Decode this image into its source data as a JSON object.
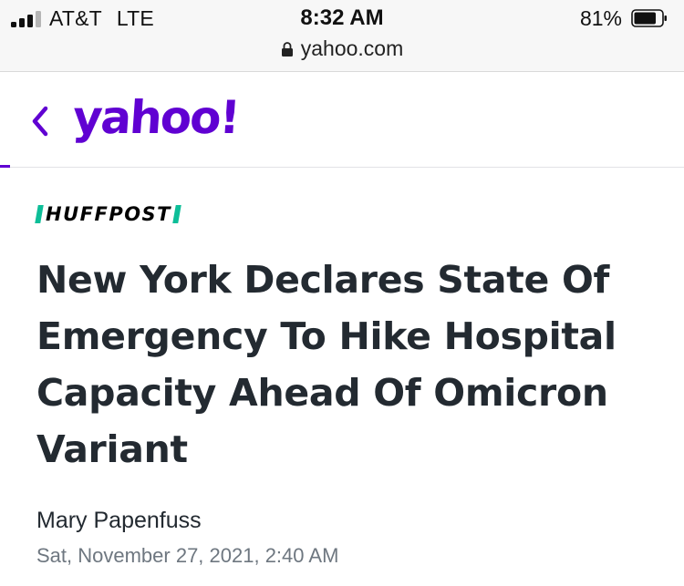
{
  "status_bar": {
    "carrier": "AT&T",
    "network": "LTE",
    "time": "8:32 AM",
    "battery_percent": "81%",
    "battery_level": 0.81,
    "signal_bars_filled": 3,
    "signal_bars_total": 4
  },
  "browser": {
    "url": "yahoo.com",
    "page_load_progress": 0.015
  },
  "header": {
    "logo_text": "yahoo!",
    "back_icon": "chevron-left-icon"
  },
  "article": {
    "publisher": "HUFFPOST",
    "headline": "New York Declares State Of Emergency To Hike Hospital Capacity Ahead Of Omicron Variant",
    "author": "Mary Papenfuss",
    "date": "Sat, November 27, 2021, 2:40 AM"
  },
  "colors": {
    "yahoo_purple": "#6001d2",
    "huffpost_green": "#0dbe98",
    "headline_text": "#232a31",
    "meta_text": "#6e7780"
  }
}
